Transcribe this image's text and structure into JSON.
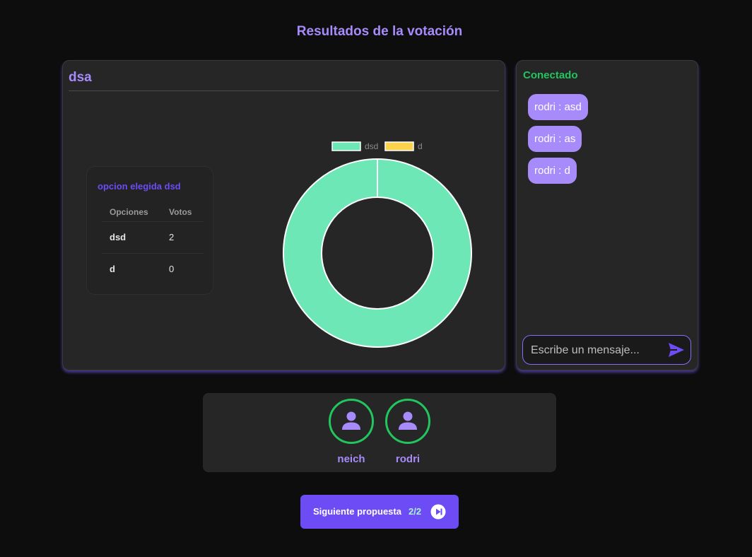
{
  "page": {
    "title": "Resultados de la votación"
  },
  "results": {
    "proposal_title": "dsa",
    "table": {
      "caption": "opcion elegida dsd",
      "headers": {
        "option": "Opciones",
        "votes": "Votos"
      },
      "rows": [
        {
          "option": "dsd",
          "votes": "2"
        },
        {
          "option": "d",
          "votes": "0"
        }
      ]
    }
  },
  "chart_data": {
    "type": "pie",
    "donut": true,
    "categories": [
      "dsd",
      "d"
    ],
    "values": [
      2,
      0
    ],
    "colors": [
      "#6ee7b7",
      "#fcd34d"
    ],
    "legend": "top",
    "title": ""
  },
  "chat": {
    "status": "Conectado",
    "status_color": "#22c55e",
    "messages": [
      "rodri : asd",
      "rodri : as",
      "rodri : d"
    ],
    "input_placeholder": "Escribe un mensaje...",
    "send_icon": "send-icon"
  },
  "participants": [
    {
      "name": "neich",
      "status_color": "#22c55e",
      "icon": "user-icon"
    },
    {
      "name": "rodri",
      "status_color": "#22c55e",
      "icon": "user-icon"
    }
  ],
  "next": {
    "label": "Siguiente propuesta",
    "counter": "2/2",
    "icon": "skip-next-icon"
  },
  "colors": {
    "accent": "#a78bfa",
    "primary_button": "#6d4cf5",
    "background": "#0d0d0d",
    "card": "#262626"
  }
}
